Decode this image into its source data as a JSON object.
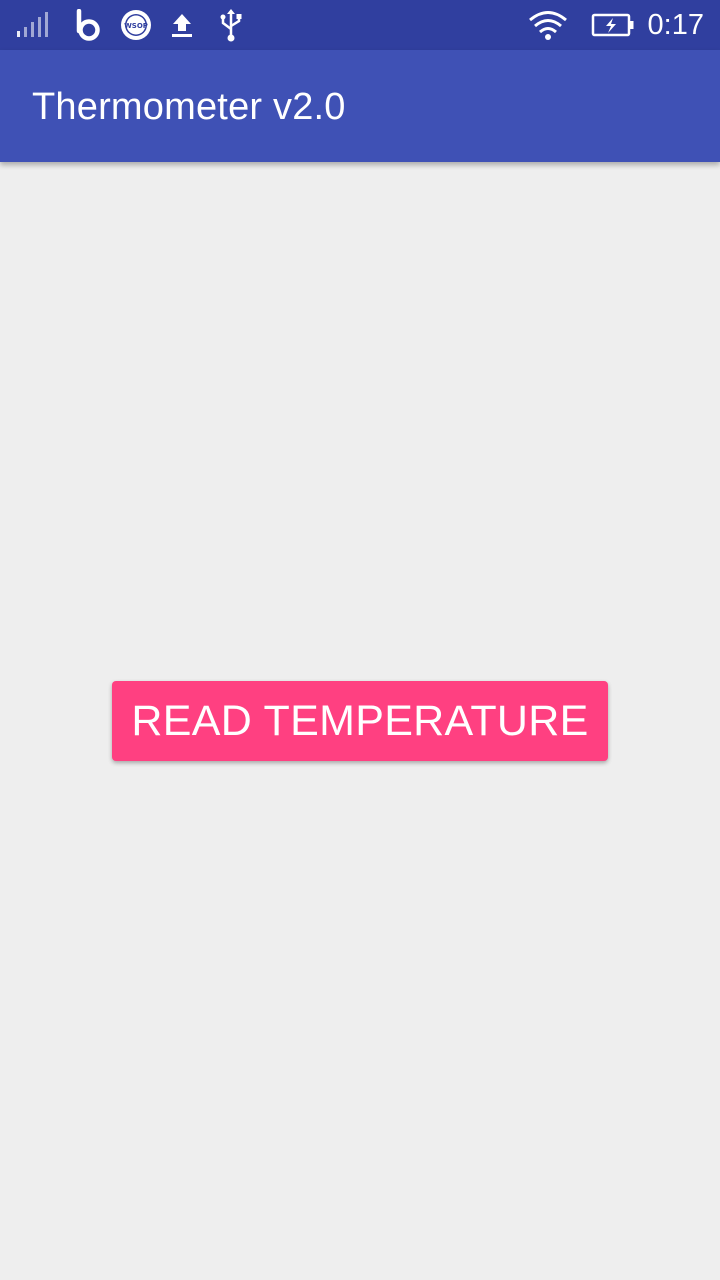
{
  "status_bar": {
    "time": "0:17",
    "icons": [
      "signal-icon",
      "b-app-icon",
      "wsop-icon",
      "upload-icon",
      "usb-icon",
      "wifi-icon",
      "battery-charging-icon"
    ],
    "wsop_label": "WSOP",
    "background_color": "#303f9f"
  },
  "app_bar": {
    "title": "Thermometer v2.0",
    "background_color": "#3f51b5"
  },
  "main": {
    "read_button_label": "READ TEMPERATURE",
    "button_color": "#ff4081",
    "background_color": "#eeeeee"
  }
}
